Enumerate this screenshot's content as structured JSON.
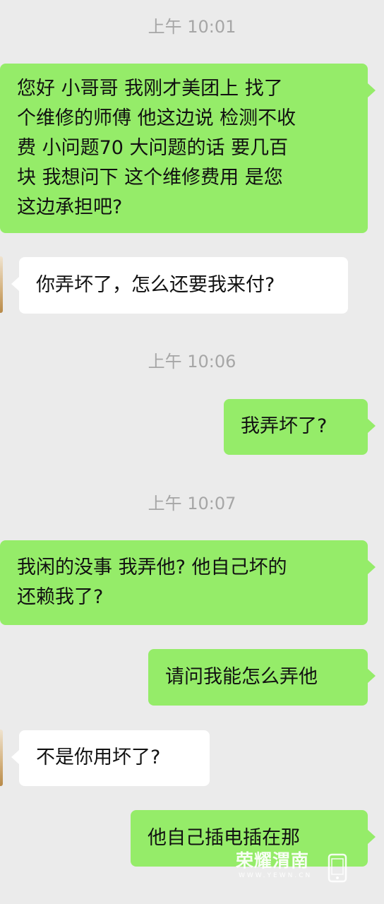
{
  "timestamps": [
    "上午 10:01",
    "上午 10:06",
    "上午 10:07"
  ],
  "messages": [
    {
      "side": "right",
      "lines": [
        "您好 小哥哥 我刚才美团上 找了",
        "个维修的师傅 他这边说 检测不收",
        "费 小问题70 大问题的话 要几百",
        "块 我想问下 这个维修费用 是您",
        "这边承担吧?"
      ]
    },
    {
      "side": "left",
      "lines": [
        "你弄坏了，怎么还要我来付?"
      ]
    },
    {
      "side": "right",
      "lines": [
        "我弄坏了?"
      ]
    },
    {
      "side": "right",
      "lines": [
        "我闲的没事 我弄他?  他自己坏的",
        " 还赖我了?"
      ]
    },
    {
      "side": "right",
      "lines": [
        "请问我能怎么弄他"
      ]
    },
    {
      "side": "left",
      "lines": [
        "不是你用坏了?"
      ]
    },
    {
      "side": "right",
      "lines": [
        "他自己插电插在那"
      ]
    }
  ],
  "watermark": {
    "title": "荣耀渭南",
    "subtitle": "WWW.YEWN.CN",
    "icon": "phone-icon"
  },
  "colors": {
    "background": "#ebebeb",
    "outgoing_bubble": "#95ec69",
    "incoming_bubble": "#ffffff",
    "timestamp": "#a6a6a6"
  }
}
